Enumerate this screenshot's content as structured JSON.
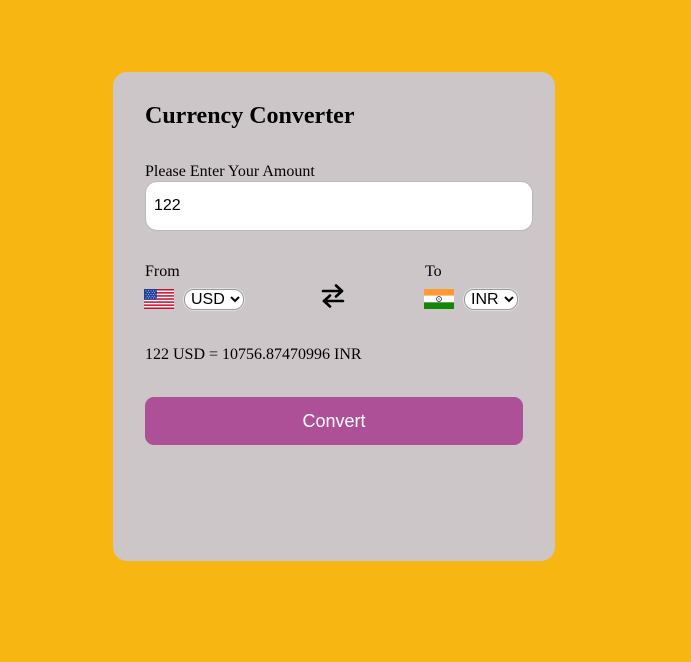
{
  "app": {
    "title": "Currency Converter"
  },
  "amount": {
    "label": "Please Enter Your Amount",
    "value": "122"
  },
  "from": {
    "label": "From",
    "selected": "USD",
    "flag_icon": "us-flag-icon"
  },
  "to": {
    "label": "To",
    "selected": "INR",
    "flag_icon": "india-flag-icon"
  },
  "swap": {
    "icon": "swap-arrows-icon"
  },
  "result": {
    "text": "122 USD = 10756.87470996 INR"
  },
  "convert": {
    "label": "Convert"
  },
  "colors": {
    "page_background": "#f7b612",
    "card_background": "#cdc6c8",
    "button_background": "#ae5097",
    "button_text": "#ffffff"
  }
}
